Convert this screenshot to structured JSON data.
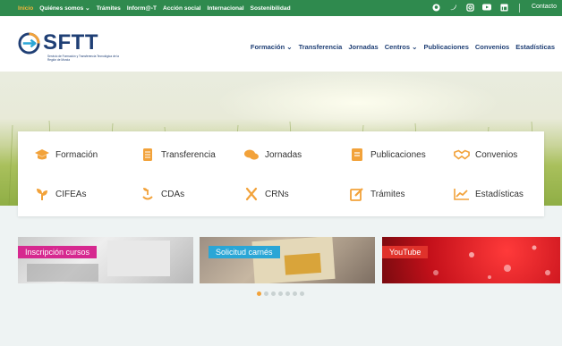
{
  "topbar": {
    "links": [
      "Inicio",
      "Quiénes somos ⌄",
      "Trámites",
      "Inform@-T",
      "Acción social",
      "Internacional",
      "Sostenibilidad"
    ],
    "active": "Inicio",
    "social_icons": [
      "github-icon",
      "twitter-icon",
      "instagram-icon",
      "youtube-icon",
      "linkedin-icon"
    ],
    "contact": "Contacto",
    "color": "#2f8a4e"
  },
  "brand": {
    "name": "SFTT",
    "subtitle": "Servicio de Formación y Transferencia Tecnológica de la Región de Murcia"
  },
  "mainnav": [
    "Formación ⌄",
    "Transferencia",
    "Jornadas",
    "Centros ⌄",
    "Publicaciones",
    "Convenios",
    "Estadísticas"
  ],
  "quicklinks": [
    {
      "label": "Formación",
      "icon": "graduation-cap-icon"
    },
    {
      "label": "Transferencia",
      "icon": "document-icon"
    },
    {
      "label": "Jornadas",
      "icon": "chat-icon"
    },
    {
      "label": "Publicaciones",
      "icon": "book-icon"
    },
    {
      "label": "Convenios",
      "icon": "handshake-icon"
    },
    {
      "label": "CIFEAs",
      "icon": "sprout-icon"
    },
    {
      "label": "CDAs",
      "icon": "seedling-icon"
    },
    {
      "label": "CRNs",
      "icon": "crossed-tools-icon"
    },
    {
      "label": "Trámites",
      "icon": "edit-icon"
    },
    {
      "label": "Estadísticas",
      "icon": "chart-icon"
    }
  ],
  "accent": "#f2a23a",
  "cards": [
    {
      "tag": "Inscripción cursos",
      "tag_color": "#d6288f"
    },
    {
      "tag": "Solicitud carnés",
      "tag_color": "#2aa6d6"
    },
    {
      "tag": "YouTube",
      "tag_color": "#e0322b"
    }
  ],
  "carousel": {
    "count": 7,
    "active": 1
  }
}
